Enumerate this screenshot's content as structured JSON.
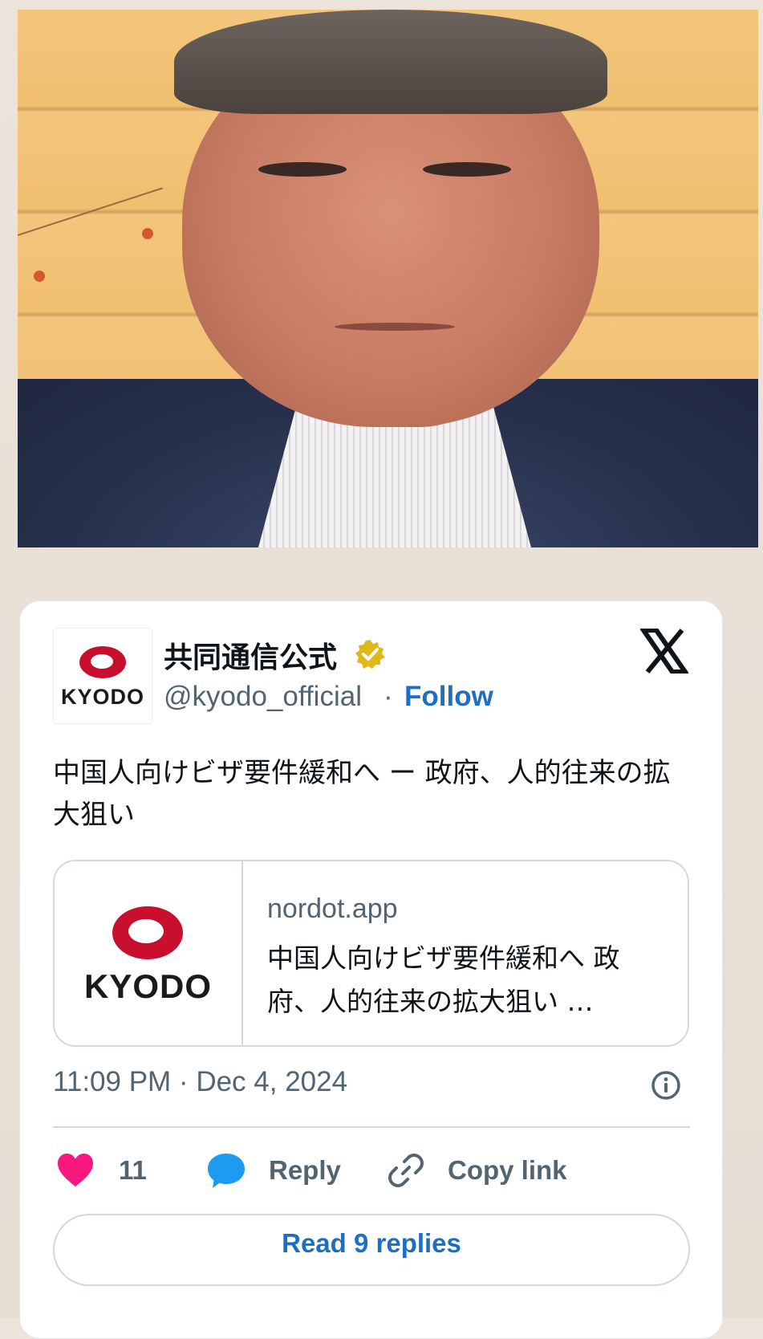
{
  "photo": {
    "subject": "news-photo"
  },
  "embed": {
    "author": {
      "name": "共同通信公式",
      "handle": "@kyodo_official",
      "separator": "·",
      "follow_label": "Follow",
      "avatar_text": "KYODO",
      "verified_icon": "verified-badge-icon"
    },
    "platform_icon": "x-logo-icon",
    "text": "中国人向けビザ要件緩和へ ー 政府、人的往来の拡大狙い",
    "link_card": {
      "thumb_text": "KYODO",
      "domain": "nordot.app",
      "title": "中国人向けビザ要件緩和へ 政府、人的往来の拡大狙い …"
    },
    "timestamp": "11:09 PM · Dec 4, 2024",
    "info_icon": "info-icon",
    "actions": {
      "like_count": "11",
      "reply_label": "Reply",
      "copy_label": "Copy link"
    },
    "read_replies_label": "Read 9 replies"
  },
  "colors": {
    "accent": "#1d6fc5",
    "like": "#f91880",
    "reply": "#1d9bf0",
    "brand_red": "#c8102e",
    "verified_gold": "#e2b719"
  }
}
